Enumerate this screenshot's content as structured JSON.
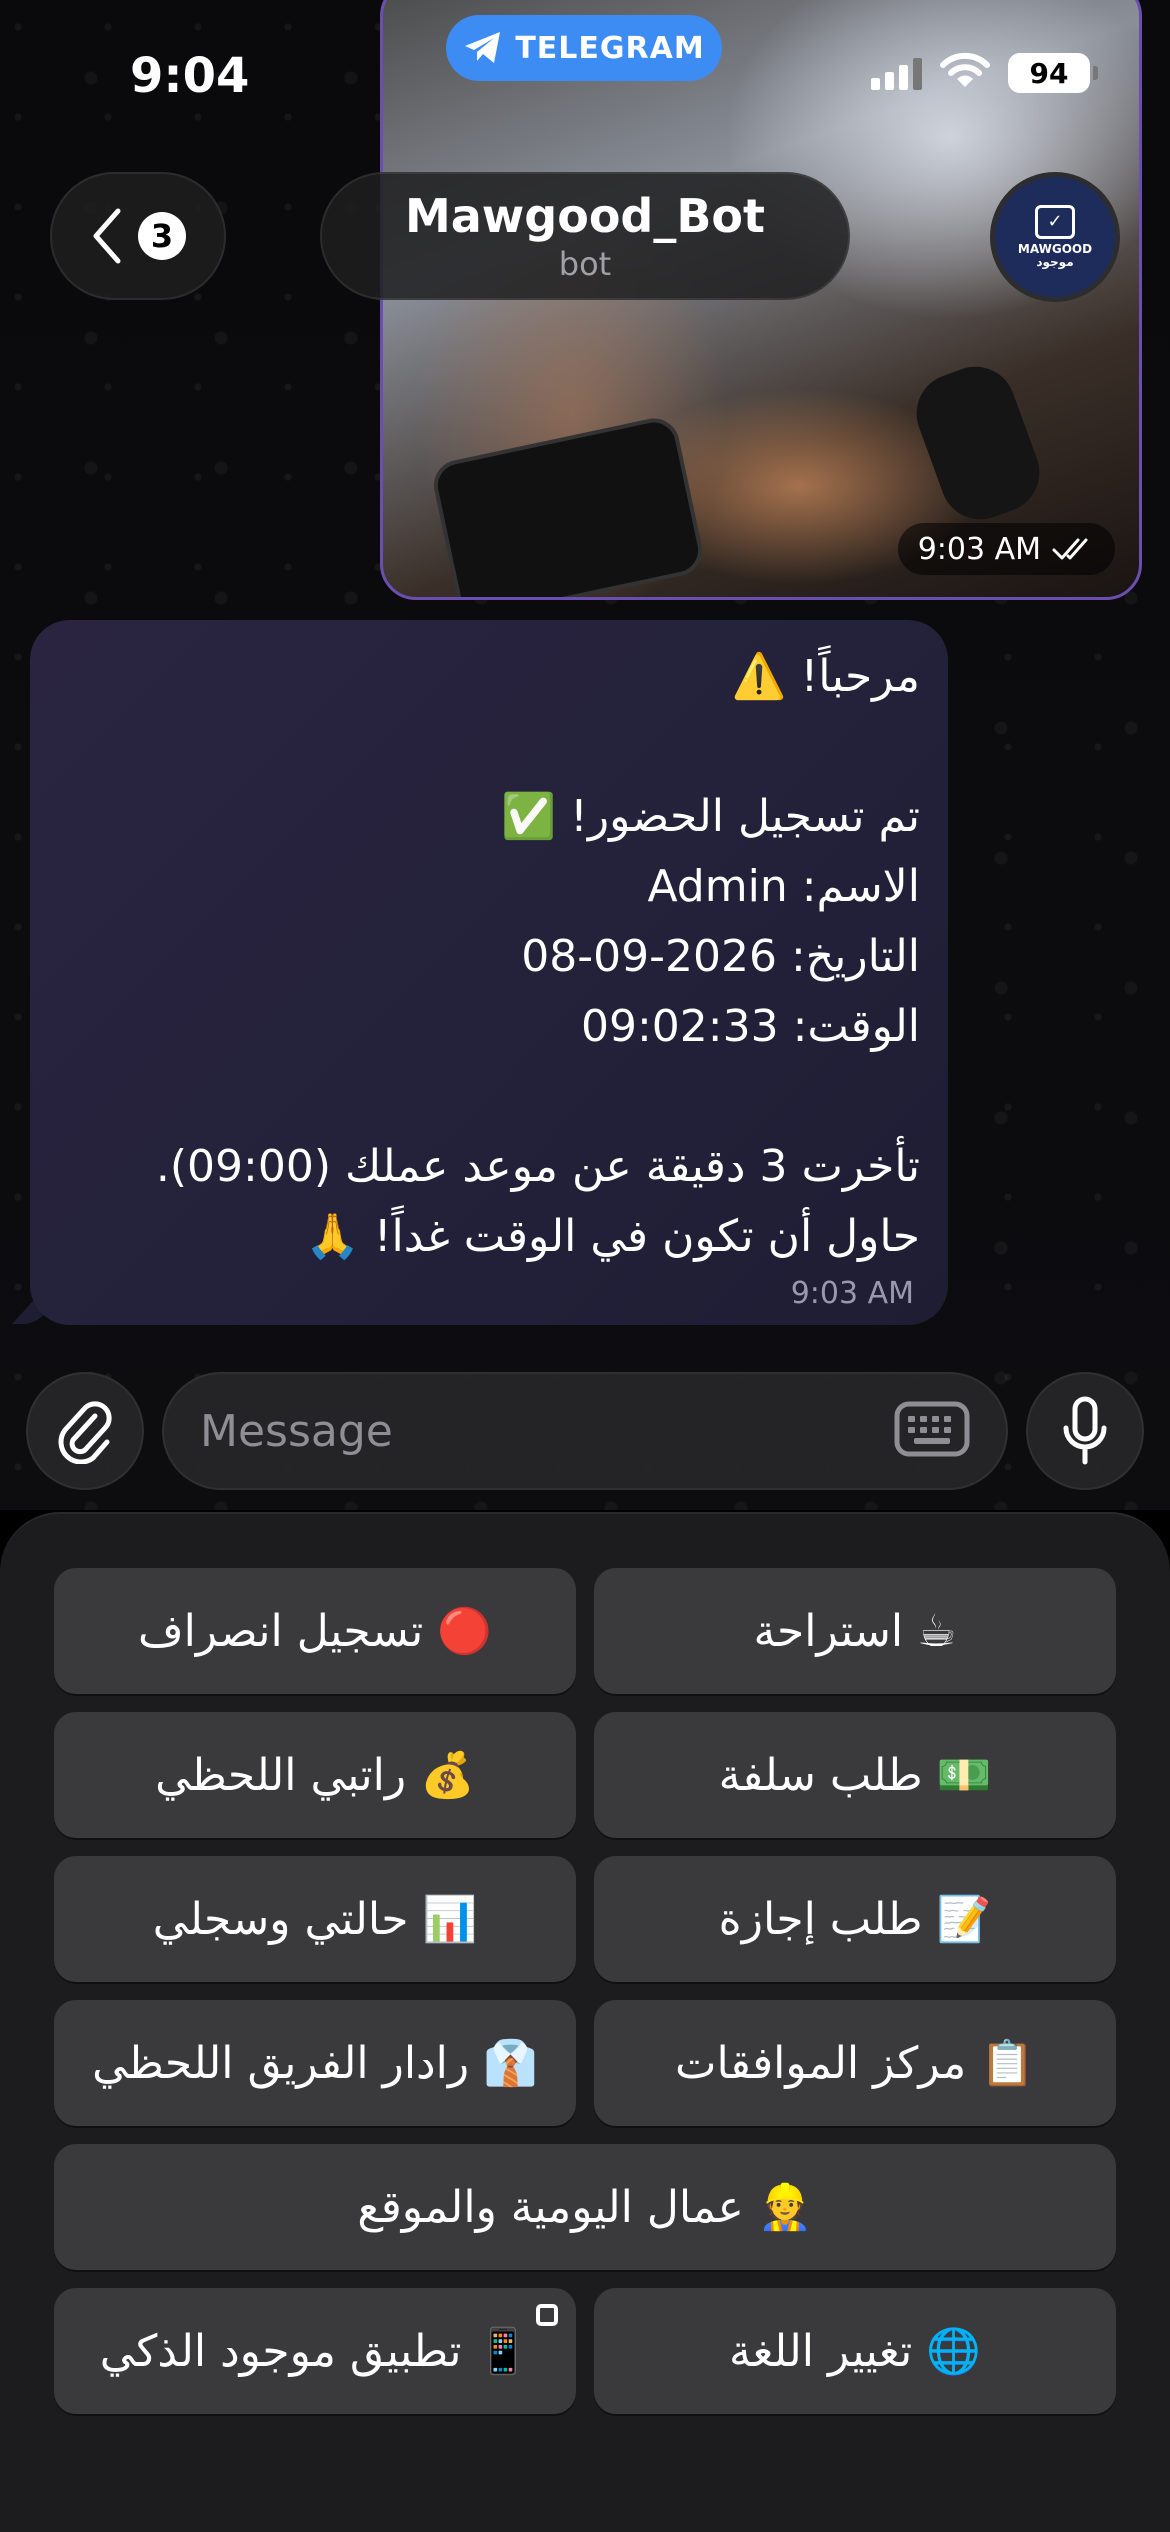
{
  "status_bar": {
    "time": "9:04",
    "app_pill": "TELEGRAM",
    "battery": "94"
  },
  "header": {
    "back_count": "3",
    "title": "Mawgood_Bot",
    "subtitle": "bot",
    "avatar_text": "MAWGOOD\nموجود"
  },
  "photo_message": {
    "time": "9:03 AM"
  },
  "text_message": {
    "line_1": "مرحباً! ⚠️",
    "line_2": "",
    "line_3": "تم تسجيل الحضور! ✅",
    "line_4": "الاسم: Admin",
    "line_5": "التاريخ: 2026-09-08",
    "line_6": "الوقت: 09:02:33",
    "line_7": "",
    "line_8": "تأخرت 3 دقيقة عن موعد عملك (09:00).",
    "line_9": "حاول أن تكون في الوقت غداً! 🙏",
    "time": "9:03 AM"
  },
  "composer": {
    "placeholder": "Message"
  },
  "keyboard": {
    "break": "☕ استراحة",
    "checkout": "🔴 تسجيل انصراف",
    "advance": "💵 طلب سلفة",
    "salary": "💰 راتبي اللحظي",
    "leave": "📝 طلب إجازة",
    "status": "📊 حالتي وسجلي",
    "approvals": "📋 مركز الموافقات",
    "radar": "👔 رادار الفريق اللحظي",
    "daily_workers": "👷 عمال اليومية والموقع",
    "language": "🌐 تغيير اللغة",
    "app": "📱 تطبيق موجود الذكي"
  }
}
